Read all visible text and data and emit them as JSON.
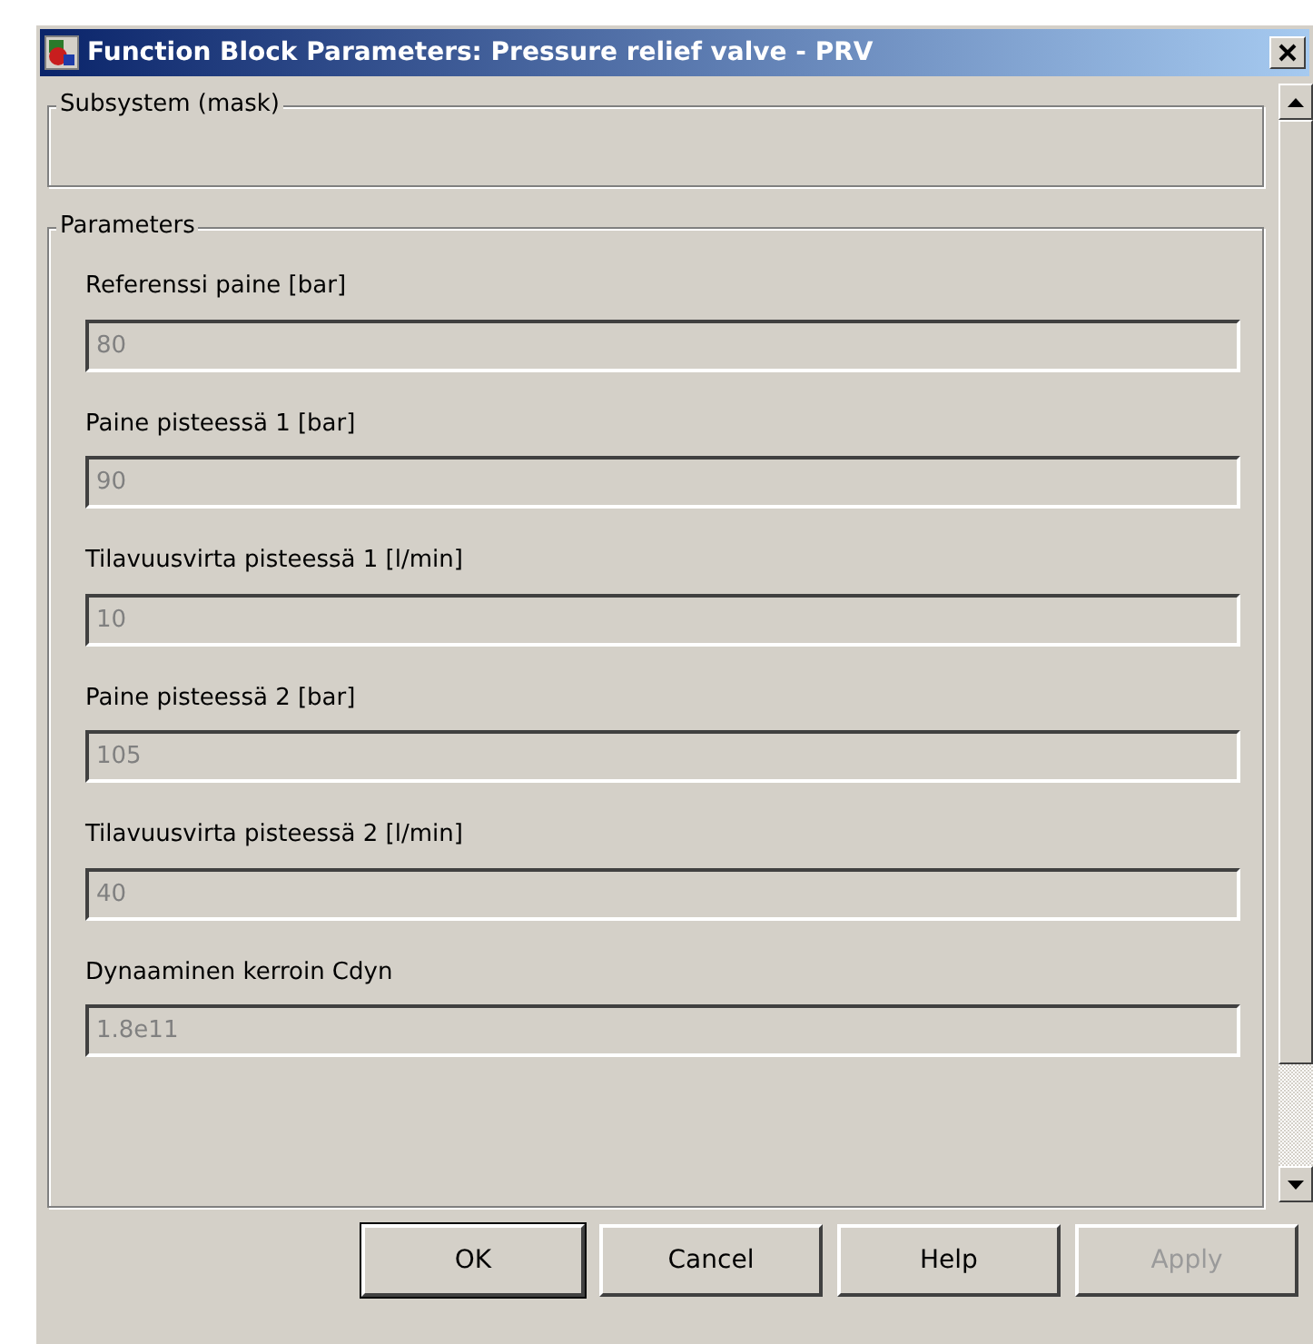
{
  "window": {
    "title": "Function Block Parameters: Pressure relief valve - PRV"
  },
  "subsystem": {
    "title": "Subsystem (mask)"
  },
  "parameters": {
    "title": "Parameters",
    "fields": [
      {
        "label": "Referenssi paine [bar]",
        "value": "80",
        "disabled": true
      },
      {
        "label": "Paine pisteessä 1 [bar]",
        "value": "90",
        "disabled": true
      },
      {
        "label": "Tilavuusvirta pisteessä 1 [l/min]",
        "value": "10",
        "disabled": true
      },
      {
        "label": "Paine pisteessä 2 [bar]",
        "value": "105",
        "disabled": true
      },
      {
        "label": "Tilavuusvirta pisteessä 2 [l/min]",
        "value": "40",
        "disabled": true
      },
      {
        "label": "Dynaaminen kerroin Cdyn",
        "value": "1.8e11",
        "disabled": true
      }
    ]
  },
  "buttons": [
    {
      "label": "OK",
      "disabled": false
    },
    {
      "label": "Cancel",
      "disabled": false
    },
    {
      "label": "Help",
      "disabled": false
    },
    {
      "label": "Apply",
      "disabled": true
    }
  ]
}
